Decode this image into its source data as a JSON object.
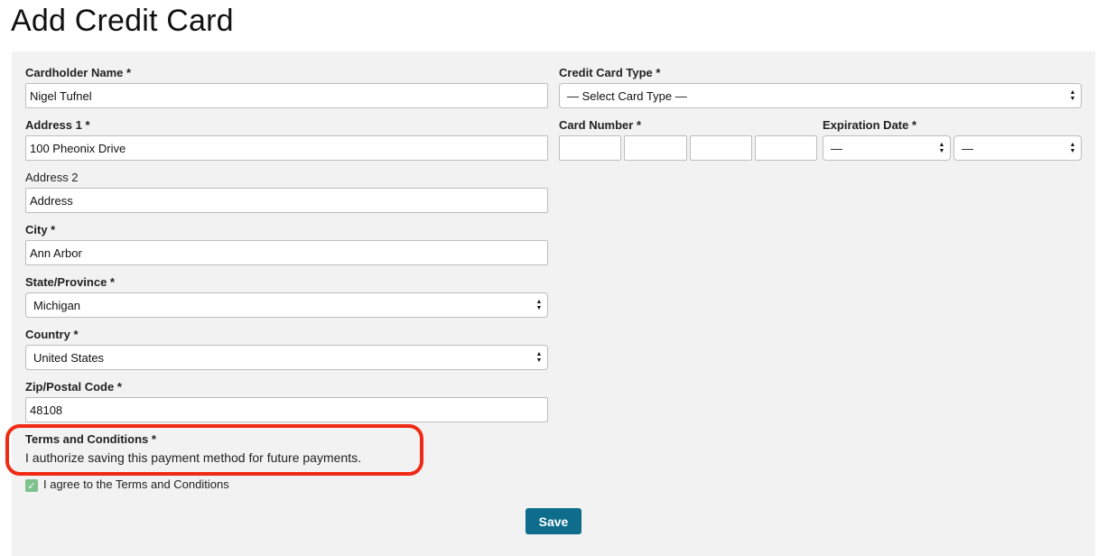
{
  "page": {
    "title": "Add Credit Card"
  },
  "form": {
    "cardholder_name": {
      "label": "Cardholder Name *",
      "value": "Nigel Tufnel"
    },
    "address1": {
      "label": "Address 1 *",
      "value": "100 Pheonix Drive"
    },
    "address2": {
      "label": "Address 2",
      "value": "Address"
    },
    "city": {
      "label": "City *",
      "value": "Ann Arbor"
    },
    "state": {
      "label": "State/Province *",
      "value": "Michigan"
    },
    "country": {
      "label": "Country *",
      "value": "United States"
    },
    "zip": {
      "label": "Zip/Postal Code *",
      "value": "48108"
    },
    "card_type": {
      "label": "Credit Card Type *",
      "value": "— Select Card Type —"
    },
    "card_number": {
      "label": "Card Number *",
      "parts": [
        "",
        "",
        "",
        ""
      ]
    },
    "expiration": {
      "label": "Expiration Date *",
      "month": "—",
      "year": "—"
    },
    "terms": {
      "label": "Terms and Conditions *",
      "text": "I authorize saving this payment method for future payments.",
      "agree_label": "I agree to the Terms and Conditions",
      "agreed": true
    },
    "save_label": "Save"
  },
  "annotation": {
    "highlight_color": "#f02a14"
  },
  "colors": {
    "button": "#0e6d8c",
    "checkbox": "#7fc18b",
    "panel": "#f2f2f2"
  },
  "icons": {
    "select_arrows": "select-arrows-icon",
    "checkmark": "checkmark-icon"
  }
}
